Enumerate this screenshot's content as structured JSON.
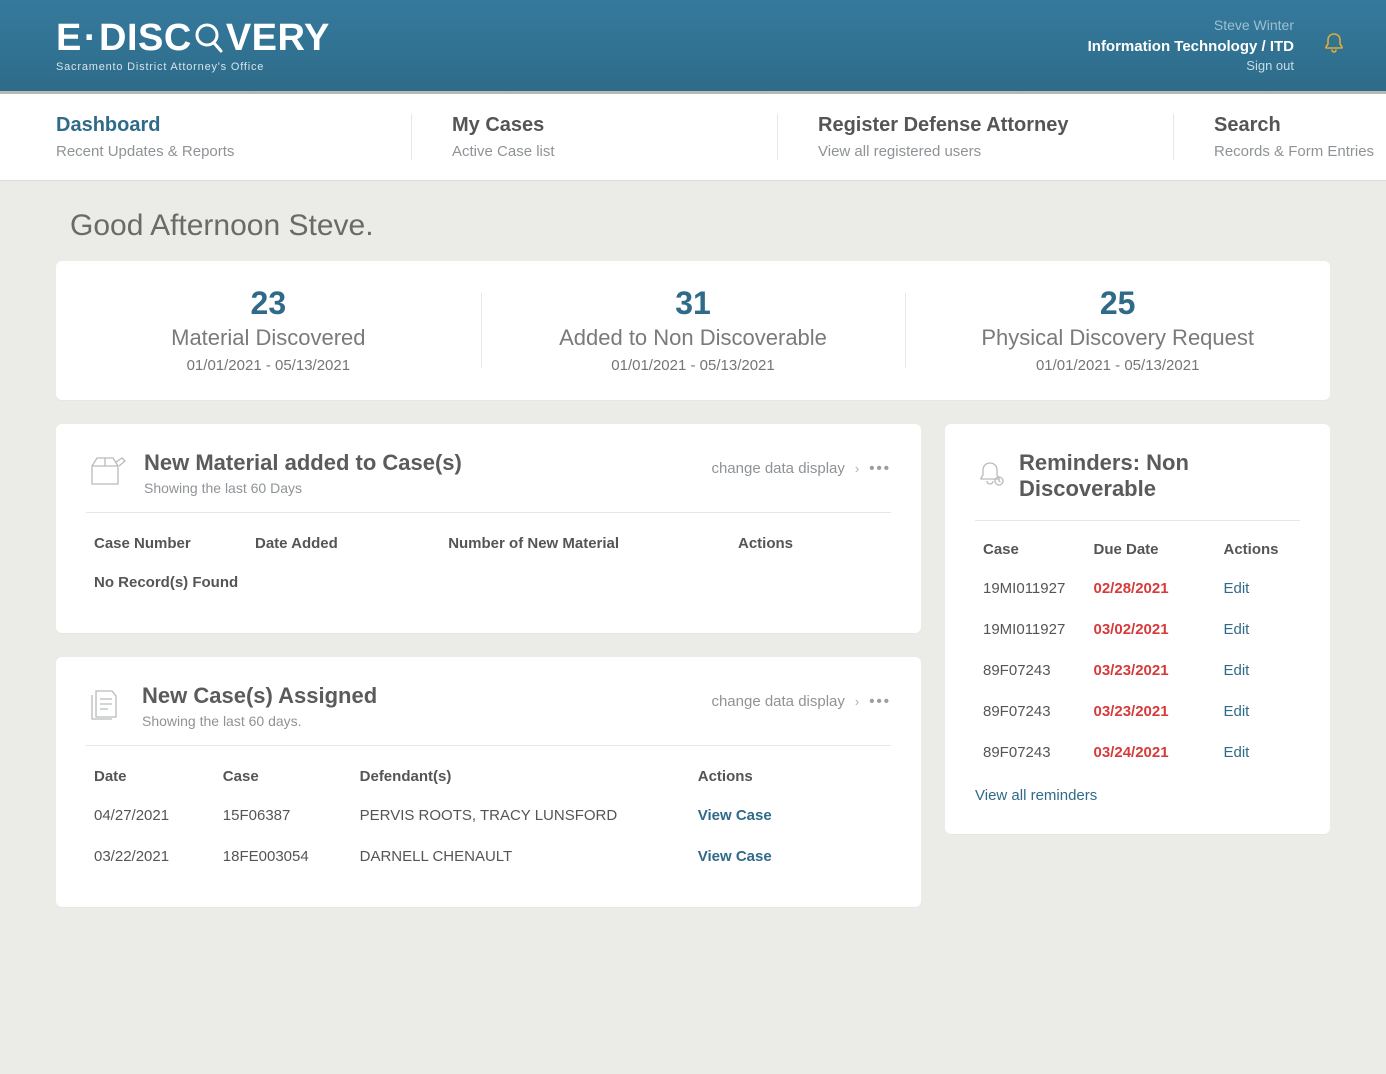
{
  "header": {
    "logo_prefix": "E",
    "logo_dot": "·",
    "logo_part1": "DISC",
    "logo_part2": "VERY",
    "logo_sub": "Sacramento District Attorney's Office",
    "user_name": "Steve Winter",
    "user_dept": "Information Technology / ITD",
    "signout": "Sign out"
  },
  "nav": [
    {
      "title": "Dashboard",
      "sub": "Recent Updates & Reports",
      "active": true
    },
    {
      "title": "My Cases",
      "sub": "Active Case list"
    },
    {
      "title": "Register Defense Attorney",
      "sub": "View all registered users"
    },
    {
      "title": "Search",
      "sub": "Records & Form Entries"
    }
  ],
  "greeting": "Good Afternoon Steve.",
  "stats": [
    {
      "num": "23",
      "label": "Material Discovered",
      "range": "01/01/2021 - 05/13/2021"
    },
    {
      "num": "31",
      "label": "Added to Non Discoverable",
      "range": "01/01/2021 - 05/13/2021"
    },
    {
      "num": "25",
      "label": "Physical Discovery Request",
      "range": "01/01/2021 - 05/13/2021"
    }
  ],
  "change_display": "change data display",
  "new_material": {
    "title": "New Material added to Case(s)",
    "sub": "Showing the last 60 Days",
    "cols": [
      "Case Number",
      "Date Added",
      "Number of New Material",
      "Actions"
    ],
    "empty": "No Record(s) Found"
  },
  "new_cases": {
    "title": "New Case(s) Assigned",
    "sub": "Showing the last 60 days.",
    "cols": [
      "Date",
      "Case",
      "Defendant(s)",
      "Actions"
    ],
    "rows": [
      {
        "date": "04/27/2021",
        "case": "15F06387",
        "def": "PERVIS ROOTS, TRACY LUNSFORD",
        "action": "View Case"
      },
      {
        "date": "03/22/2021",
        "case": "18FE003054",
        "def": "DARNELL CHENAULT",
        "action": "View Case"
      }
    ]
  },
  "reminders": {
    "title": "Reminders: Non Discoverable",
    "cols": [
      "Case",
      "Due Date",
      "Actions"
    ],
    "rows": [
      {
        "case": "19MI011927",
        "due": "02/28/2021",
        "action": "Edit"
      },
      {
        "case": "19MI011927",
        "due": "03/02/2021",
        "action": "Edit"
      },
      {
        "case": "89F07243",
        "due": "03/23/2021",
        "action": "Edit"
      },
      {
        "case": "89F07243",
        "due": "03/23/2021",
        "action": "Edit"
      },
      {
        "case": "89F07243",
        "due": "03/24/2021",
        "action": "Edit"
      }
    ],
    "viewall": "View all reminders"
  }
}
